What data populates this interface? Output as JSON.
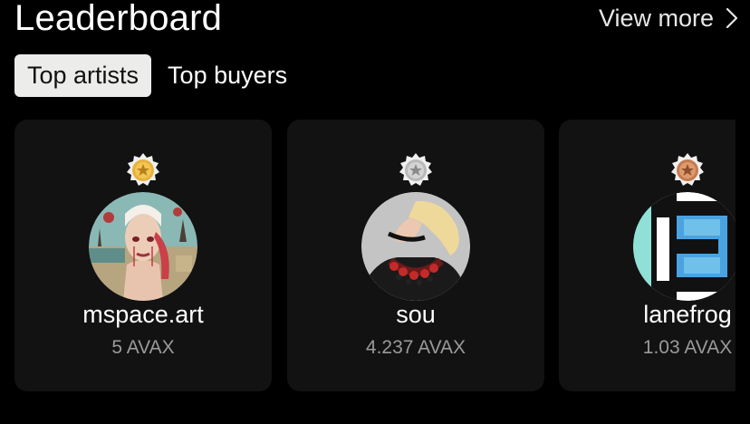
{
  "header": {
    "title": "Leaderboard",
    "view_more_label": "View more"
  },
  "tabs": [
    {
      "label": "Top artists",
      "active": true
    },
    {
      "label": "Top buyers",
      "active": false
    }
  ],
  "cards": [
    {
      "rank_medal": "gold-medal-icon",
      "avatar": "surreal-portrait-avatar",
      "name": "mspace.art",
      "amount": "5 AVAX"
    },
    {
      "rank_medal": "silver-medal-icon",
      "avatar": "blonde-woman-avatar",
      "name": "sou",
      "amount": "4.237 AVAX"
    },
    {
      "rank_medal": "bronze-medal-icon",
      "avatar": "lanefrog-logo-avatar",
      "name": "lanefrog",
      "amount": "1.03 AVAX"
    }
  ],
  "colors": {
    "background": "#000000",
    "card": "#121212",
    "active_tab": "#ececea",
    "muted_text": "#9a9a9a",
    "gold": "#e8b23a",
    "silver": "#c8c8c8",
    "bronze": "#d08a5e"
  }
}
